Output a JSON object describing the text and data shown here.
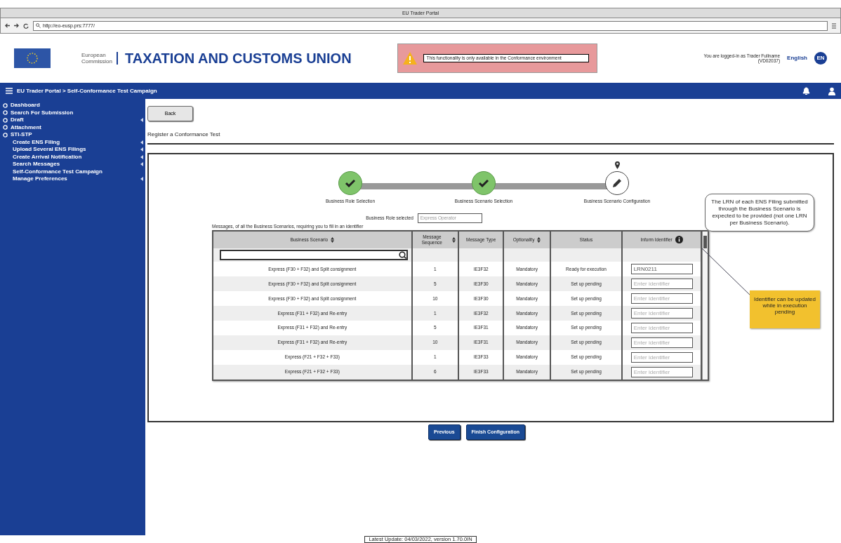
{
  "browser": {
    "title": "EU Trader Portal",
    "url": "http://eo-eusp.prs:7777/"
  },
  "header": {
    "org_line1": "European",
    "org_line2": "Commission",
    "title": "TAXATION AND CUSTOMS UNION",
    "warning": "This functionality is only available in the Conformance environment",
    "user_line1": "You are logged-in as Trader Fullname",
    "user_line2": "(VD02037)",
    "language": "English",
    "language_code": "EN"
  },
  "navbar": {
    "breadcrumb": "EU Trader Portal > Self-Conformance Test Campaign"
  },
  "sidebar": {
    "items": [
      {
        "label": "Dashboard",
        "arrow": false
      },
      {
        "label": "Search For Submission",
        "arrow": false
      },
      {
        "label": "Draft",
        "arrow": true
      },
      {
        "label": "Attachment",
        "arrow": false
      },
      {
        "label": "STI-STP",
        "arrow": false,
        "children": [
          {
            "label": "Create ENS Filing",
            "arrow": true
          },
          {
            "label": "Upload Several ENS Filings",
            "arrow": true
          },
          {
            "label": "Create Arrival Notification",
            "arrow": true
          },
          {
            "label": "Search Messages",
            "arrow": true
          },
          {
            "label": "Self-Conformance Test Campaign",
            "arrow": false
          },
          {
            "label": "Manage Preferences",
            "arrow": true
          }
        ]
      }
    ]
  },
  "back_button": "Back",
  "page_title": "Register a Conformance Test",
  "steps": [
    {
      "label": "Business Role Selection",
      "completed": true
    },
    {
      "label": "Business Scenario Selection",
      "completed": true
    },
    {
      "label": "Business Scenario Configuration",
      "completed": false
    }
  ],
  "role_selected": {
    "label": "Business Role selected",
    "value": "Express Operator"
  },
  "table": {
    "intro": "Messages, of all the Business Scenarios, requiring you to fill in an identifier",
    "columns": [
      {
        "label": "Business Scenario",
        "sortable": true
      },
      {
        "label": "Message Sequence",
        "sortable": true
      },
      {
        "label": "Message Type",
        "sortable": false
      },
      {
        "label": "Optionality",
        "sortable": true
      },
      {
        "label": "Status",
        "sortable": false
      },
      {
        "label": "Inform Identifier",
        "sortable": false,
        "info": true
      }
    ],
    "rows": [
      {
        "scenario": "Express (F30 + F32) and Split consignment",
        "sequence": "1",
        "type": "IE3F32",
        "optionality": "Mandatory",
        "status": "Ready for execution",
        "identifier": {
          "value": "LRN0211"
        }
      },
      {
        "scenario": "Express (F30 + F32) and Split consignment",
        "sequence": "5",
        "type": "IE3F30",
        "optionality": "Mandatory",
        "status": "Set up pending",
        "identifier": {
          "placeholder": "Enter identifier"
        }
      },
      {
        "scenario": "Express (F30 + F32) and Split consignment",
        "sequence": "10",
        "type": "IE3F30",
        "optionality": "Mandatory",
        "status": "Set up pending",
        "identifier": {
          "placeholder": "Enter identifier"
        }
      },
      {
        "scenario": "Express (F31 + F32) and Re-entry",
        "sequence": "1",
        "type": "IE3F32",
        "optionality": "Mandatory",
        "status": "Set up pending",
        "identifier": {
          "placeholder": "Enter identifier"
        }
      },
      {
        "scenario": "Express (F31 + F32) and Re-entry",
        "sequence": "5",
        "type": "IE3F31",
        "optionality": "Mandatory",
        "status": "Set up pending",
        "identifier": {
          "placeholder": "Enter identifier"
        }
      },
      {
        "scenario": "Express (F31 + F32) and Re-entry",
        "sequence": "10",
        "type": "IE3F31",
        "optionality": "Mandatory",
        "status": "Set up pending",
        "identifier": {
          "placeholder": "Enter identifier"
        }
      },
      {
        "scenario": "Express (F21 + F32 + F33)",
        "sequence": "1",
        "type": "IE3F33",
        "optionality": "Mandatory",
        "status": "Set up pending",
        "identifier": {
          "placeholder": "Enter identifier"
        }
      },
      {
        "scenario": "Express (F21 + F32 + F33)",
        "sequence": "6",
        "type": "IE3F33",
        "optionality": "Mandatory",
        "status": "Set up pending",
        "identifier": {
          "placeholder": "Enter identifier"
        }
      }
    ]
  },
  "callout": "The LRN of each ENS Filing submitted through the Business Scenario is expected to be provided (not one LRN per Business Scenario).",
  "note": "Identifier can be updated while in execution pending",
  "buttons": [
    {
      "label": "Previous"
    },
    {
      "label": "Finish Configuration"
    }
  ],
  "footer": "Latest Update: 04/03/2022, version 1.70.0IN"
}
